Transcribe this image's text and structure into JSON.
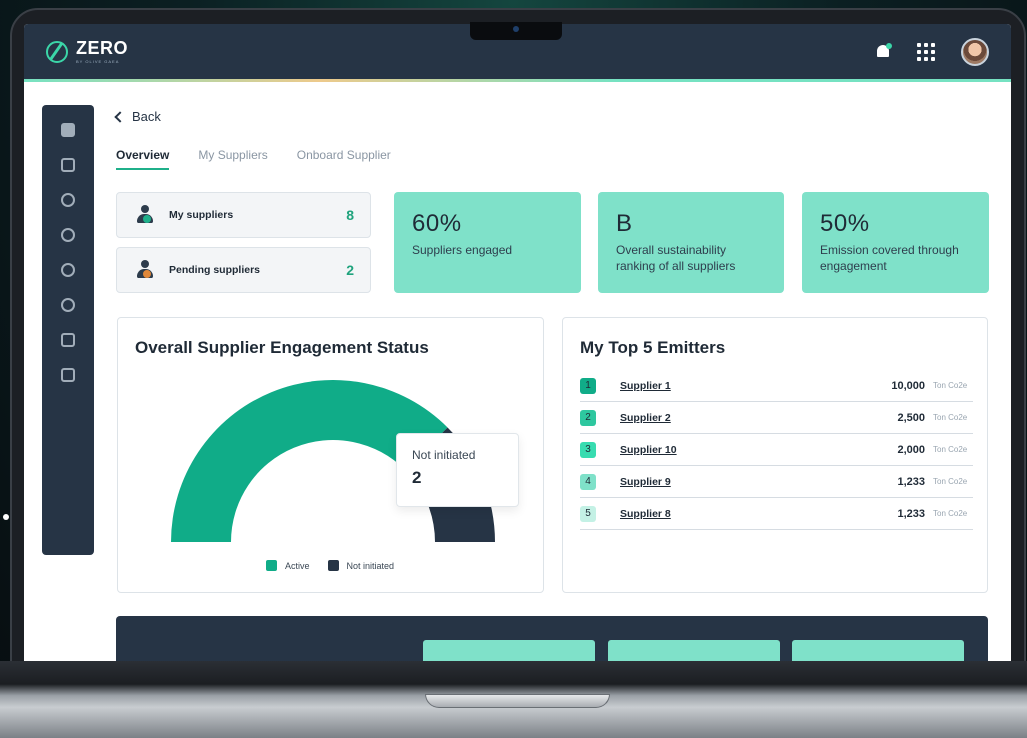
{
  "app": {
    "logo_text": "ZERO",
    "logo_subtitle": "BY OLIVE GAEA"
  },
  "nav": {
    "back_label": "Back",
    "tabs": [
      {
        "label": "Overview",
        "active": true
      },
      {
        "label": "My Suppliers",
        "active": false
      },
      {
        "label": "Onboard Supplier",
        "active": false
      }
    ]
  },
  "supplier_summary": [
    {
      "label": "My suppliers",
      "count": "8",
      "badge_color": "#1fb08a"
    },
    {
      "label": "Pending suppliers",
      "count": "2",
      "badge_color": "#e0883a"
    }
  ],
  "stats": [
    {
      "value": "60%",
      "description": "Suppliers engaged"
    },
    {
      "value": "B",
      "description": "Overall sustainability ranking of all suppliers"
    },
    {
      "value": "50%",
      "description": "Emission covered through engagement"
    }
  ],
  "engagement": {
    "title": "Overall Supplier Engagement Status",
    "tooltip_label": "Not initiated",
    "tooltip_value": "2",
    "legend": [
      {
        "label": "Active",
        "color": "#10ac88"
      },
      {
        "label": "Not initiated",
        "color": "#263445"
      }
    ],
    "chart_data": {
      "type": "pie",
      "categories": [
        "Active",
        "Not initiated"
      ],
      "values": [
        6,
        2
      ]
    }
  },
  "emitters": {
    "title": "My Top 5 Emitters",
    "rows": [
      {
        "rank": "1",
        "name": "Supplier 1",
        "value": "10,000",
        "unit": "Ton Co2e",
        "color": "#10ac88"
      },
      {
        "rank": "2",
        "name": "Supplier 2",
        "value": "2,500",
        "unit": "Ton Co2e",
        "color": "#2ec79f"
      },
      {
        "rank": "3",
        "name": "Supplier 10",
        "value": "2,000",
        "unit": "Ton Co2e",
        "color": "#38dcb0"
      },
      {
        "rank": "4",
        "name": "Supplier 9",
        "value": "1,233",
        "unit": "Ton Co2e",
        "color": "#7fe1c9"
      },
      {
        "rank": "5",
        "name": "Supplier 8",
        "value": "1,233",
        "unit": "Ton Co2e",
        "color": "#c4f1e5"
      }
    ]
  },
  "colors": {
    "brand_dark": "#263445",
    "accent_green": "#10ac88",
    "mint": "#7fe1c9"
  },
  "icons": [
    "bell-icon",
    "apps-grid-icon",
    "avatar",
    "dashboard-icon",
    "reports-icon",
    "analytics-icon",
    "target-icon",
    "sustainability-icon",
    "co2-icon",
    "document-icon",
    "modules-icon"
  ]
}
